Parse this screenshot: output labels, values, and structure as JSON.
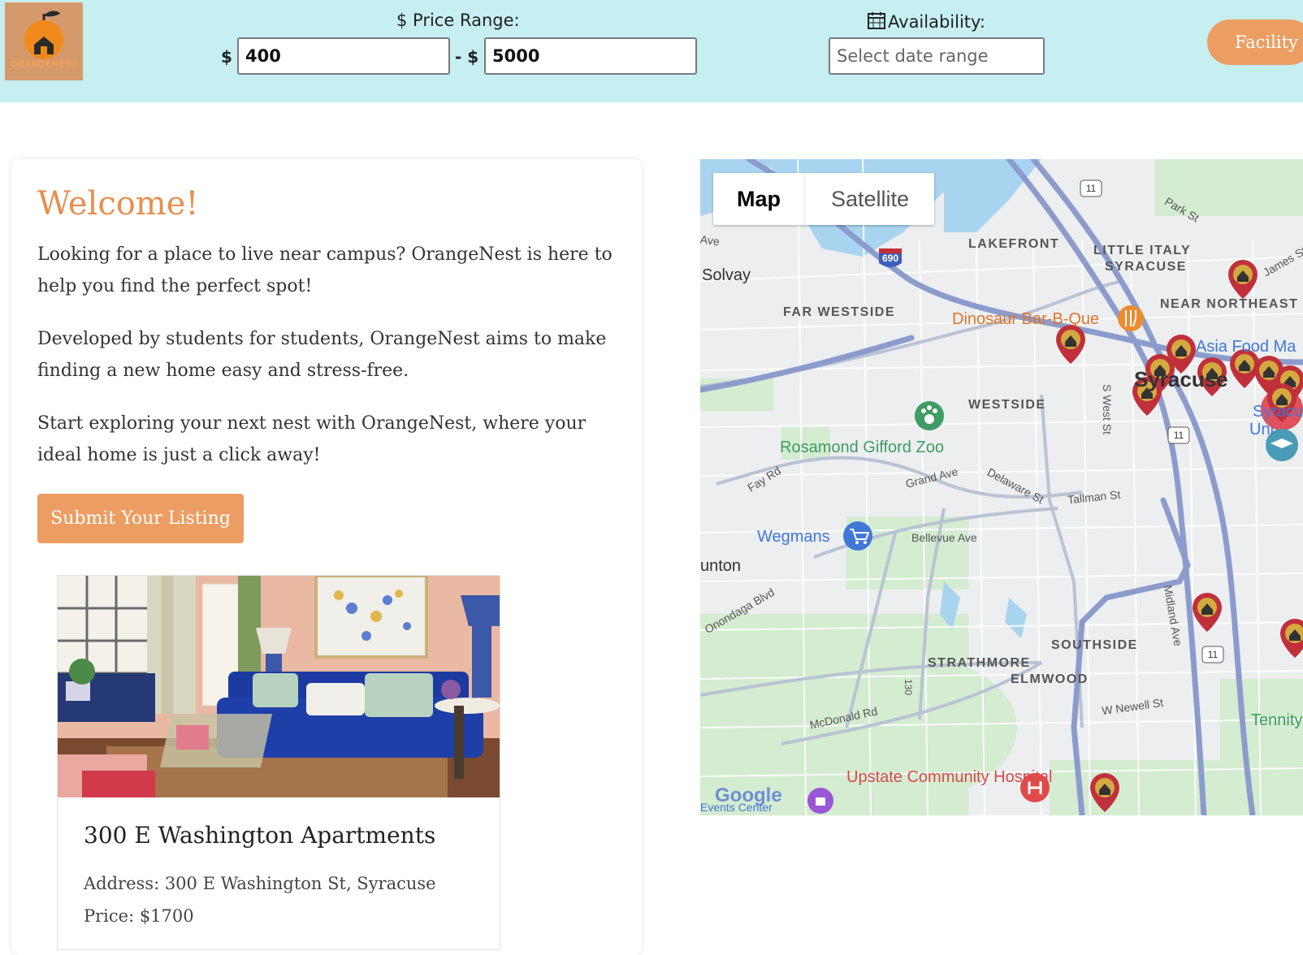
{
  "header": {
    "logo_text": "ORANGENEST",
    "price_range_label": "$ Price Range:",
    "min_prefix": "$",
    "min_price": "400",
    "max_prefix": "- $",
    "max_price": "5000",
    "availability_label": "Availability:",
    "date_placeholder": "Select date range",
    "facility_button": "Facility"
  },
  "welcome": {
    "title": "Welcome!",
    "paragraphs": [
      "Looking for a place to live near campus? OrangeNest is here to help you find the perfect spot!",
      "Developed by students for students, OrangeNest aims to make finding a new home easy and stress-free.",
      "Start exploring your next nest with OrangeNest, where your ideal home is just a click away!"
    ],
    "submit_button": "Submit Your Listing"
  },
  "listing": {
    "title": "300 E Washington Apartments",
    "address": "Address: 300 E Washington St, Syracuse",
    "price": "Price: $1700"
  },
  "map": {
    "toggle_map": "Map",
    "toggle_satellite": "Satellite",
    "neighborhoods": [
      "LAKEFRONT",
      "LITTLE ITALY",
      "SYRACUSE",
      "FAR WESTSIDE",
      "NEAR NORTHEAST",
      "WESTSIDE",
      "SOUTHSIDE",
      "STRATHMORE",
      "ELMWOOD"
    ],
    "roads": [
      "Park St",
      "James St",
      "S West St",
      "Fay Rd",
      "Grand Ave",
      "Delaware St",
      "Tallman St",
      "Bellevue Ave",
      "Midland Ave",
      "W Newell St",
      "McDonald Rd",
      "Onondaga Blvd",
      "Ave"
    ],
    "places": [
      "Solvay",
      "Dinosaur Bar-B-Que",
      "Asia Food Ma",
      "Syracuse",
      "Rosamond Gifford Zoo",
      "Wegmans",
      "unton",
      "Upstate Community Hospital",
      "Tennity",
      "Syracu",
      "Uni",
      "Events Center"
    ],
    "route_shields": [
      "11",
      "690",
      "11",
      "11",
      "130"
    ],
    "google": "Google",
    "colors": {
      "water": "#a8d4f0",
      "park": "#d4ecd0",
      "highway": "#8b9ccc",
      "pin": "#c0303a"
    }
  },
  "icons": [
    "calendar-icon",
    "fork-knife-icon",
    "paw-icon",
    "cart-icon",
    "hospital-icon",
    "graduation-cap-icon",
    "home-pin-icon"
  ]
}
